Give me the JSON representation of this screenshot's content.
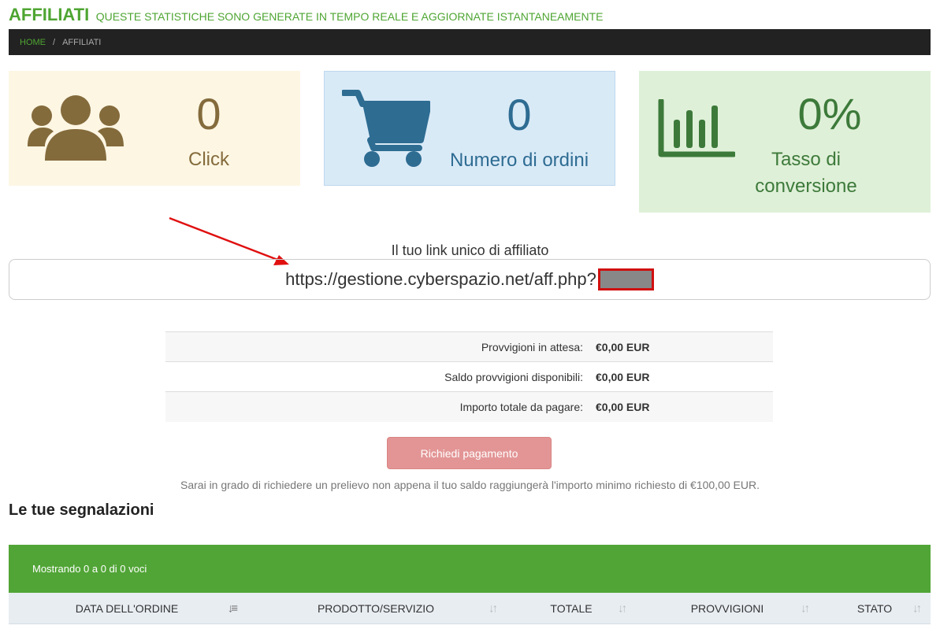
{
  "header": {
    "title": "AFFILIATI",
    "subtitle": "QUESTE STATISTICHE SONO GENERATE IN TEMPO REALE E AGGIORNATE ISTANTANEAMENTE"
  },
  "breadcrumb": {
    "home": "HOME",
    "separator": "/",
    "current": "AFFILIATI"
  },
  "stats": {
    "clicks": {
      "value": "0",
      "label": "Click",
      "icon": "users-icon",
      "color": "#846b3c",
      "bg": "#fdf6e3"
    },
    "orders": {
      "value": "0",
      "label": "Numero di ordini",
      "icon": "cart-icon",
      "color": "#2e6c92",
      "bg": "#d9eaf7"
    },
    "conversion": {
      "value": "0%",
      "label": "Tasso di conversione",
      "icon": "bar-chart-icon",
      "color": "#3d7a3a",
      "bg": "#dff0d8"
    }
  },
  "affiliate_link": {
    "label": "Il tuo link unico di affiliato",
    "url": "https://gestione.cyberspazio.net/aff.php?"
  },
  "commissions": [
    {
      "label": "Provvigioni in attesa:",
      "value": "€0,00 EUR"
    },
    {
      "label": "Saldo provvigioni disponibili:",
      "value": "€0,00 EUR"
    },
    {
      "label": "Importo totale da pagare:",
      "value": "€0,00 EUR"
    }
  ],
  "payment": {
    "button_label": "Richiedi pagamento",
    "note": "Sarai in grado di richiedere un prelievo non appena il tuo saldo raggiungerà l'importo minimo richiesto di €100,00 EUR."
  },
  "referrals": {
    "title": "Le tue segnalazioni",
    "showing": "Mostrando 0 a 0 di 0 voci",
    "columns": [
      "DATA DELL'ORDINE",
      "PRODOTTO/SERVIZIO",
      "TOTALE",
      "PROVVIGIONI",
      "STATO"
    ]
  },
  "colors": {
    "brand_green": "#4ea532",
    "table_bar_green": "#51a536",
    "button_disabled": "#e39595",
    "annotation_red": "#e01010"
  }
}
